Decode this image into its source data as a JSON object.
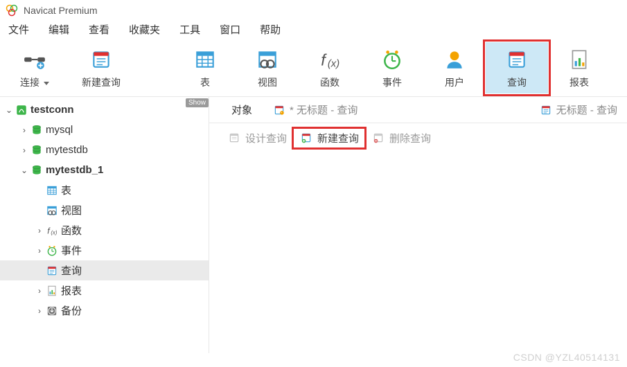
{
  "title": "Navicat Premium",
  "menu": [
    "文件",
    "编辑",
    "查看",
    "收藏夹",
    "工具",
    "窗口",
    "帮助"
  ],
  "toolbar": [
    {
      "id": "connect",
      "label": "连接",
      "caret": true,
      "selected": false
    },
    {
      "id": "newquery",
      "label": "新建查询",
      "caret": false,
      "selected": false
    },
    {
      "id": "table",
      "label": "表",
      "caret": false,
      "selected": false
    },
    {
      "id": "view",
      "label": "视图",
      "caret": false,
      "selected": false
    },
    {
      "id": "function",
      "label": "函数",
      "caret": false,
      "selected": false
    },
    {
      "id": "event",
      "label": "事件",
      "caret": false,
      "selected": false
    },
    {
      "id": "user",
      "label": "用户",
      "caret": false,
      "selected": false
    },
    {
      "id": "query",
      "label": "查询",
      "caret": false,
      "selected": true
    },
    {
      "id": "report",
      "label": "报表",
      "caret": false,
      "selected": false
    }
  ],
  "sidebar": {
    "show_tag": "Show",
    "tree": [
      {
        "depth": 0,
        "twist": "open",
        "icon": "connection",
        "label": "testconn",
        "bold": true
      },
      {
        "depth": 1,
        "twist": "closed",
        "icon": "database",
        "label": "mysql"
      },
      {
        "depth": 1,
        "twist": "closed",
        "icon": "database",
        "label": "mytestdb"
      },
      {
        "depth": 1,
        "twist": "open",
        "icon": "database",
        "label": "mytestdb_1",
        "bold": true
      },
      {
        "depth": 2,
        "twist": "none",
        "icon": "table",
        "label": "表"
      },
      {
        "depth": 2,
        "twist": "none",
        "icon": "view",
        "label": "视图"
      },
      {
        "depth": 2,
        "twist": "closed",
        "icon": "function",
        "label": "函数"
      },
      {
        "depth": 2,
        "twist": "closed",
        "icon": "event",
        "label": "事件"
      },
      {
        "depth": 2,
        "twist": "none",
        "icon": "query",
        "label": "查询",
        "selected": true
      },
      {
        "depth": 2,
        "twist": "closed",
        "icon": "report",
        "label": "报表"
      },
      {
        "depth": 2,
        "twist": "closed",
        "icon": "backup",
        "label": "备份"
      }
    ]
  },
  "tabs": [
    {
      "id": "objects",
      "icon": "none",
      "label": "对象",
      "active": true
    },
    {
      "id": "untitled1",
      "icon": "query-mod",
      "label": "* 无标题 - 查询",
      "active": false
    },
    {
      "id": "untitled2",
      "icon": "query",
      "label": "无标题 - 查询",
      "active": false
    }
  ],
  "actions": [
    {
      "id": "design",
      "icon": "query-gray",
      "label": "设计查询",
      "enabled": false
    },
    {
      "id": "new",
      "icon": "query-add",
      "label": "新建查询",
      "enabled": true,
      "highlight": true
    },
    {
      "id": "delete",
      "icon": "query-del",
      "label": "删除查询",
      "enabled": false
    }
  ],
  "watermark": "CSDN @YZL40514131",
  "colors": {
    "accent": "#3a9fd8",
    "green": "#3db54a",
    "orange": "#f4a300",
    "red": "#e03030"
  }
}
